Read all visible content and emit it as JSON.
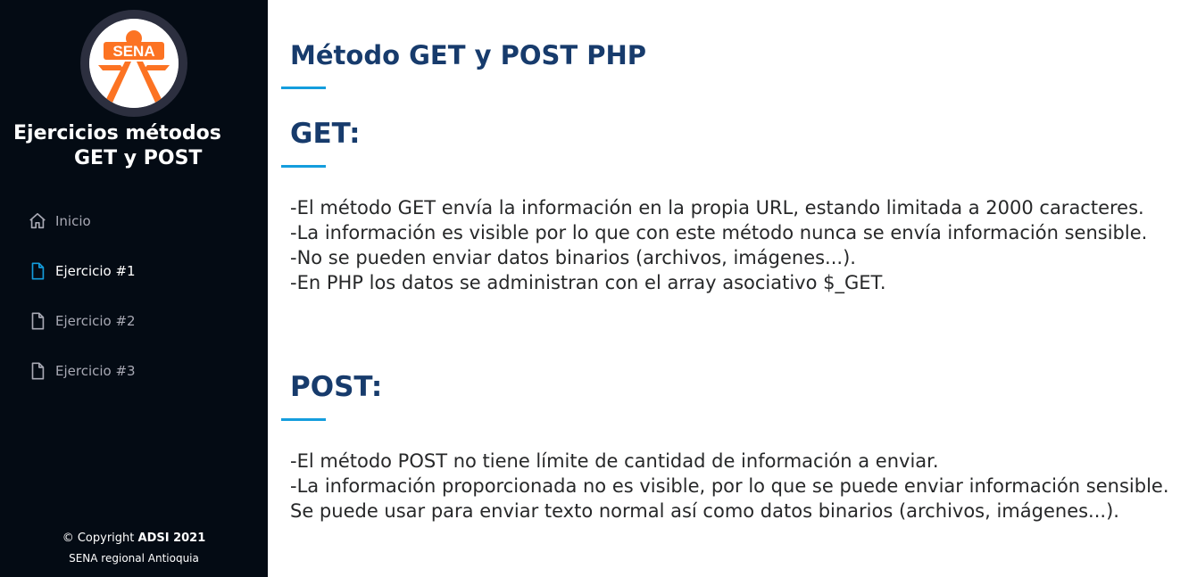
{
  "sidebar": {
    "logo": {
      "text": "SENA",
      "icon": "sena-logo",
      "colors": {
        "orange": "#fc7323",
        "ring": "#2c2f3f"
      }
    },
    "title_line1": "Ejercicios métodos",
    "title_line2": "GET y POST",
    "nav": [
      {
        "label": "Inicio",
        "icon": "home-icon",
        "active": false
      },
      {
        "label": "Ejercicio #1",
        "icon": "file-icon",
        "active": true
      },
      {
        "label": "Ejercicio #2",
        "icon": "file-icon",
        "active": false
      },
      {
        "label": "Ejercicio #3",
        "icon": "file-icon",
        "active": false
      }
    ],
    "footer": {
      "copyright_prefix": "© Copyright ",
      "copyright_strong": "ADSI 2021",
      "credits": "SENA regional Antioquia"
    }
  },
  "main": {
    "title": "Método GET y POST PHP",
    "get": {
      "heading": "GET:",
      "lines": [
        "-El método GET envía la información en la propia URL, estando limitada a 2000 caracteres.",
        "-La información es visible por lo que con este método nunca se envía información sensible.",
        "-No se pueden enviar datos binarios (archivos, imágenes...).",
        "-En PHP los datos se administran con el array asociativo $_GET."
      ]
    },
    "post": {
      "heading": "POST:",
      "lines": [
        "-El método POST no tiene límite de cantidad de información a enviar.",
        "-La información proporcionada no es visible, por lo que se puede enviar información sensible.",
        "Se puede usar para enviar texto normal así como datos binarios (archivos, imágenes...)."
      ]
    }
  },
  "colors": {
    "sidebar_bg": "#040b14",
    "heading": "#173b6c",
    "accent": "#149ddd",
    "text": "#272829",
    "nav_muted": "#a8a9b4"
  }
}
